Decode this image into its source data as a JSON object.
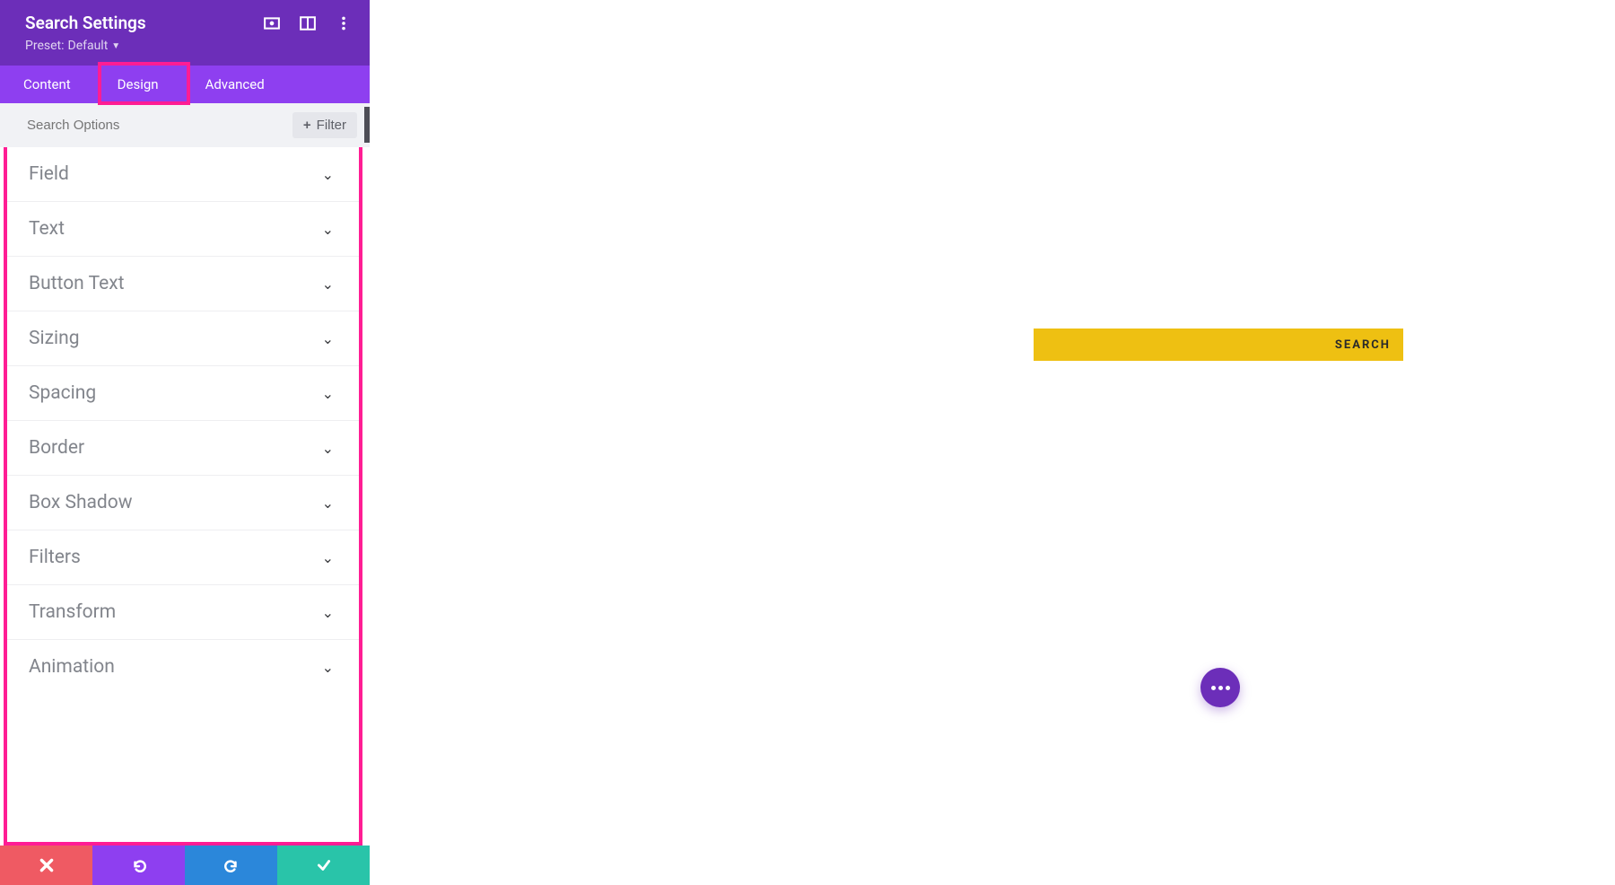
{
  "header": {
    "title": "Search Settings",
    "preset_label": "Preset:",
    "preset_value": "Default"
  },
  "tabs": [
    {
      "label": "Content"
    },
    {
      "label": "Design"
    },
    {
      "label": "Advanced"
    }
  ],
  "search": {
    "placeholder": "Search Options",
    "filter_label": "Filter"
  },
  "options": [
    {
      "label": "Field"
    },
    {
      "label": "Text"
    },
    {
      "label": "Button Text"
    },
    {
      "label": "Sizing"
    },
    {
      "label": "Spacing"
    },
    {
      "label": "Border"
    },
    {
      "label": "Box Shadow"
    },
    {
      "label": "Filters"
    },
    {
      "label": "Transform"
    },
    {
      "label": "Animation"
    }
  ],
  "preview": {
    "search_button": "SEARCH"
  }
}
